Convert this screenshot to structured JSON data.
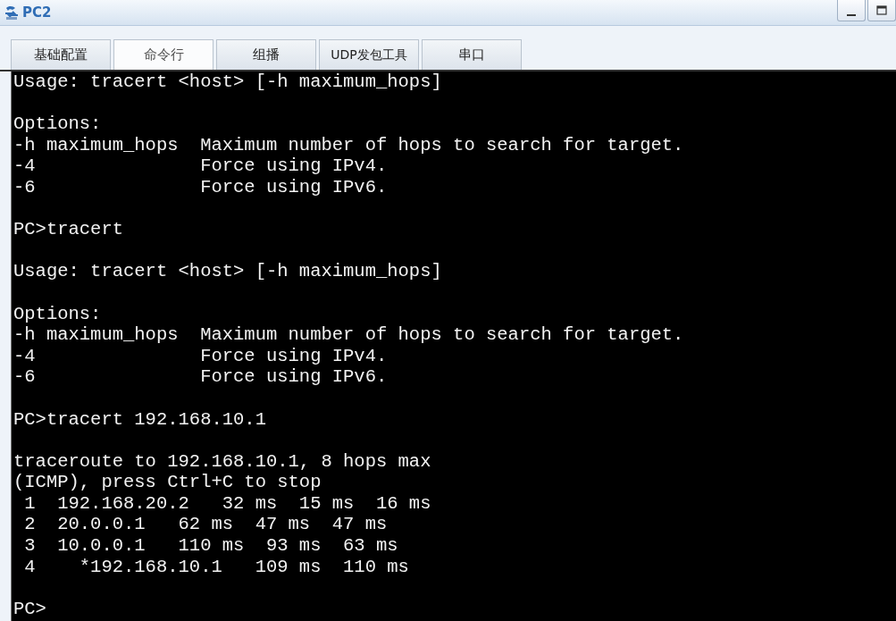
{
  "window": {
    "title": "PC2"
  },
  "tabs": [
    {
      "label": "基础配置",
      "selected": false
    },
    {
      "label": "命令行",
      "selected": true
    },
    {
      "label": "组播",
      "selected": false
    },
    {
      "label": "UDP发包工具",
      "selected": false
    },
    {
      "label": "串口",
      "selected": false
    }
  ],
  "terminal": {
    "blocks": [
      [
        "Usage: tracert <host> [-h maximum_hops]"
      ],
      [
        "Options:",
        "-h maximum_hops  Maximum number of hops to search for target.",
        "-4               Force using IPv4.",
        "-6               Force using IPv6."
      ],
      [
        "PC>tracert"
      ],
      [
        "Usage: tracert <host> [-h maximum_hops]"
      ],
      [
        "Options:",
        "-h maximum_hops  Maximum number of hops to search for target.",
        "-4               Force using IPv4.",
        "-6               Force using IPv6."
      ],
      [
        "PC>tracert 192.168.10.1"
      ],
      [
        "traceroute to 192.168.10.1, 8 hops max",
        "(ICMP), press Ctrl+C to stop",
        " 1  192.168.20.2   32 ms  15 ms  16 ms",
        " 2  20.0.0.1   62 ms  47 ms  47 ms",
        " 3  10.0.0.1   110 ms  93 ms  63 ms",
        " 4    *192.168.10.1   109 ms  110 ms"
      ],
      [
        "PC>"
      ]
    ]
  }
}
